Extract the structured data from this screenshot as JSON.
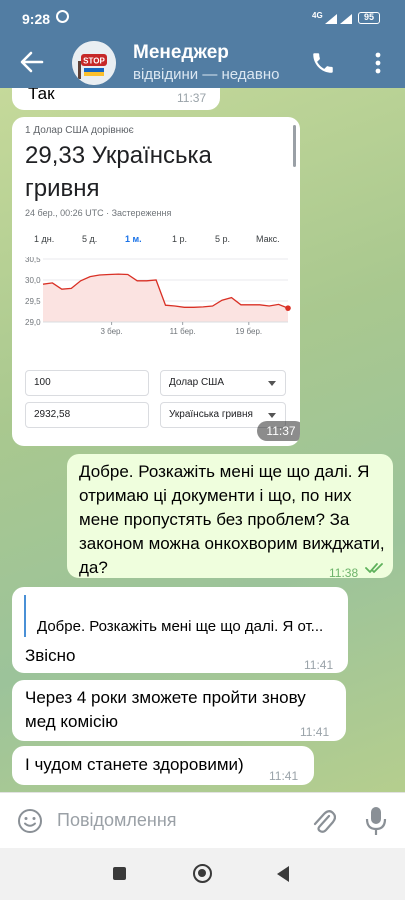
{
  "status_bar": {
    "time": "9:28",
    "network": "4G",
    "battery": "95"
  },
  "header": {
    "back_icon": "arrow-left-icon",
    "title": "Менеджер",
    "subtitle": "відвідини — недавно",
    "avatar_text": "STOP",
    "call_icon": "phone-icon",
    "menu_icon": "kebab-menu-icon"
  },
  "messages": [
    {
      "text": "Так",
      "time": "11:37",
      "type": "incoming"
    },
    {
      "type": "incoming-image",
      "time": "11:37",
      "image": {
        "label": "1 Долар США дорівнює",
        "rate": "29,33 Українська гривня",
        "date": "24 бер., 00:26 UTC · Застереження",
        "tabs": [
          "1 дн.",
          "5 д.",
          "1 м.",
          "1 р.",
          "5 р.",
          "Макс."
        ],
        "selected_tab": "1 м.",
        "amount_from": "100",
        "currency_from": "Долар США",
        "amount_to": "2932,58",
        "currency_to": "Українська гривня"
      }
    },
    {
      "text": "Добре. Розкажіть мені ще що далі. Я отримаю ці документи і що, по них мене пропустять без проблем? За законом можна онкохворим вижджати, да?",
      "time": "11:38",
      "type": "outgoing",
      "status": "read"
    },
    {
      "reply_to": "Добре. Розкажіть мені ще що далі. Я от...",
      "text": "Звісно",
      "time": "11:41",
      "type": "incoming"
    },
    {
      "text": "Через 4 роки зможете пройти знову мед комісію",
      "time": "11:41",
      "type": "incoming"
    },
    {
      "text": "І чудом станете здоровими)",
      "time": "11:41",
      "type": "incoming"
    }
  ],
  "chart_data": {
    "type": "line",
    "x_ticks": [
      "3 бер.",
      "11 бер.",
      "19 бер."
    ],
    "y_ticks": [
      "30,5",
      "30,0",
      "29,5",
      "29,0"
    ],
    "ylim": [
      29.0,
      30.5
    ],
    "series": [
      {
        "values": [
          29.9,
          29.93,
          29.78,
          29.8,
          29.98,
          30.08,
          30.12,
          30.13,
          30.14,
          30.13,
          29.98,
          29.98,
          30.0,
          29.4,
          29.38,
          29.35,
          29.35,
          29.36,
          29.38,
          29.52,
          29.58,
          29.41,
          29.41,
          29.41,
          29.38,
          29.42,
          29.33
        ]
      }
    ],
    "colors": {
      "line": "#d93025",
      "fill": "#fbe3e1"
    }
  },
  "input": {
    "placeholder": "Повідомлення",
    "emoji_icon": "smiley-icon",
    "attach_icon": "paperclip-icon",
    "mic_icon": "microphone-icon"
  },
  "nav": {
    "recent_icon": "square-icon",
    "home_icon": "circle-icon",
    "back_icon": "triangle-back-icon"
  },
  "colors": {
    "header": "#527da3",
    "outgoing_bubble": "#effedd",
    "incoming_bubble": "#ffffff"
  }
}
